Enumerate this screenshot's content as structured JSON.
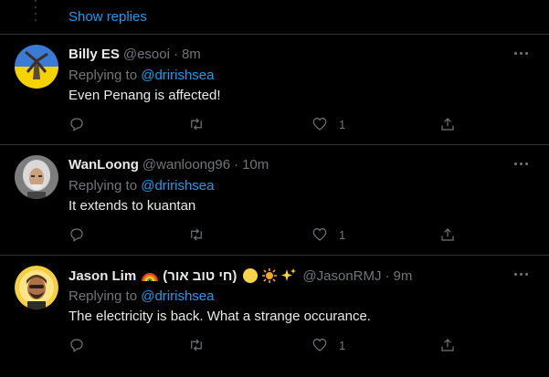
{
  "thread": {
    "show_replies_label": "Show replies"
  },
  "tweets": [
    {
      "display_name": "Billy ES",
      "handle": "@esooi",
      "separator": "·",
      "time": "8m",
      "replying_prefix": "Replying to",
      "replying_to": "@dririshsea",
      "text": "Even Penang is affected!",
      "like_count": "1",
      "avatar_colors": {
        "top": "#3a7bd5",
        "bottom": "#f5d300"
      }
    },
    {
      "display_name": "WanLoong",
      "handle": "@wanloong96",
      "separator": "·",
      "time": "10m",
      "replying_prefix": "Replying to",
      "replying_to": "@dririshsea",
      "text": "It extends to kuantan",
      "like_count": "1",
      "avatar_colors": {
        "bg": "#8a8a8a"
      }
    },
    {
      "display_name": "Jason Lim",
      "name_suffix": "(חי טוב אור)",
      "handle": "@JasonRMJ",
      "separator": "·",
      "time": "9m",
      "replying_prefix": "Replying to",
      "replying_to": "@dririshsea",
      "text": "The electricity is back. What a strange occurance.",
      "like_count": "1",
      "avatar_colors": {
        "bg": "#f5cf3d"
      }
    }
  ],
  "colors": {
    "accent": "#1d9bf0",
    "muted": "#71767b",
    "divider": "#2f3336",
    "background": "#000000"
  },
  "icons": [
    "reply-icon",
    "retweet-icon",
    "like-icon",
    "share-icon",
    "more-icon"
  ]
}
